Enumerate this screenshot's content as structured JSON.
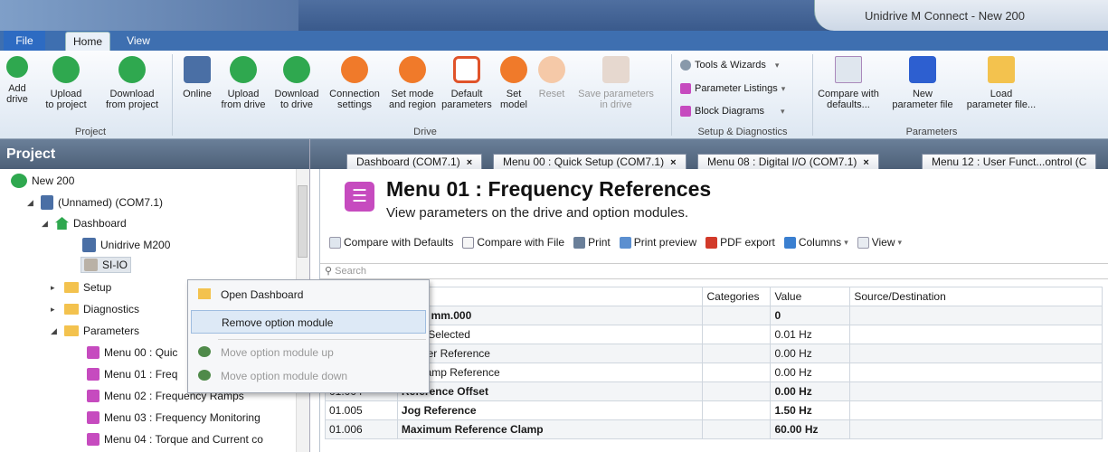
{
  "window": {
    "title": "Unidrive M Connect - New 200"
  },
  "tabs": {
    "file": "File",
    "home": "Home",
    "view": "View"
  },
  "ribbon": {
    "project": {
      "group": "Project",
      "add_drive": [
        "Add",
        "drive"
      ],
      "upload_project": [
        "Upload",
        "to project"
      ],
      "download_project": [
        "Download",
        "from project"
      ]
    },
    "drive": {
      "group": "Drive",
      "online": [
        "Online",
        ""
      ],
      "upload_drive": [
        "Upload",
        "from drive"
      ],
      "download_drive": [
        "Download",
        "to drive"
      ],
      "connection": [
        "Connection",
        "settings"
      ],
      "set_mode": [
        "Set mode",
        "and region"
      ],
      "default_params": [
        "Default",
        "parameters"
      ],
      "set_model": [
        "Set",
        "model"
      ],
      "reset": [
        "Reset",
        ""
      ],
      "save_params": [
        "Save parameters",
        "in drive"
      ]
    },
    "setup": {
      "group": "Setup & Diagnostics",
      "tools": "Tools & Wizards",
      "listings": "Parameter Listings",
      "block": "Block Diagrams"
    },
    "parameters": {
      "group": "Parameters",
      "compare": [
        "Compare with",
        "defaults..."
      ],
      "new_file": [
        "New",
        "parameter file"
      ],
      "load_file": [
        "Load",
        "parameter file..."
      ]
    }
  },
  "project": {
    "header": "Project",
    "tree": {
      "root": "New 200",
      "drive": "(Unnamed) (COM7.1)",
      "dashboard": "Dashboard",
      "unidrive": "Unidrive M200",
      "siio": "SI-IO",
      "setup": "Setup",
      "diagnostics": "Diagnostics",
      "parameters": "Parameters",
      "menu00": "Menu 00 : Quic",
      "menu01": "Menu 01 : Freq",
      "menu02": "Menu 02 : Frequency Ramps",
      "menu03": "Menu 03 : Frequency Monitoring",
      "menu04": "Menu 04 : Torque and Current co"
    }
  },
  "context_menu": {
    "open": "Open Dashboard",
    "remove": "Remove option module",
    "move_up": "Move option module up",
    "move_down": "Move option module down"
  },
  "doc_tabs": [
    "Dashboard (COM7.1)",
    "Menu 00 : Quick Setup (COM7.1)",
    "Menu 08 : Digital I/O (COM7.1)",
    "Menu 12 : User Funct...ontrol (C"
  ],
  "page": {
    "title": "Menu 01 : Frequency References",
    "subtitle": "View parameters on the drive and option modules.",
    "toolbar": {
      "compare_defaults": "Compare with Defaults",
      "compare_file": "Compare with File",
      "print": "Print",
      "print_preview": "Print preview",
      "pdf": "PDF export",
      "columns": "Columns",
      "view": "View"
    },
    "search_placeholder": "Search",
    "columns": [
      "",
      "on",
      "Categories",
      "Value",
      "Source/Destination"
    ],
    "rows": [
      {
        "id": "",
        "name": "neter mm.000",
        "cat": "",
        "value": "0",
        "bold": true
      },
      {
        "id": "",
        "name": "ence Selected",
        "cat": "",
        "value": "0.01 Hz",
        "bold": false
      },
      {
        "id": "",
        "name": "ip Filter Reference",
        "cat": "",
        "value": "0.00 Hz",
        "bold": false
      },
      {
        "id": "01.003",
        "name": "Pre-ramp Reference",
        "cat": "",
        "value": "0.00 Hz",
        "bold": false
      },
      {
        "id": "01.004",
        "name": "Reference Offset",
        "cat": "",
        "value": "0.00 Hz",
        "bold": true
      },
      {
        "id": "01.005",
        "name": "Jog Reference",
        "cat": "",
        "value": "1.50 Hz",
        "bold": true
      },
      {
        "id": "01.006",
        "name": "Maximum Reference Clamp",
        "cat": "",
        "value": "60.00 Hz",
        "bold": true
      }
    ]
  },
  "colors": {
    "accent": "#2d6bc2",
    "menu_icon": "#c64bbf",
    "folder": "#f3c24e",
    "drive_green": "#2fa84f",
    "orange": "#f07a2a"
  }
}
